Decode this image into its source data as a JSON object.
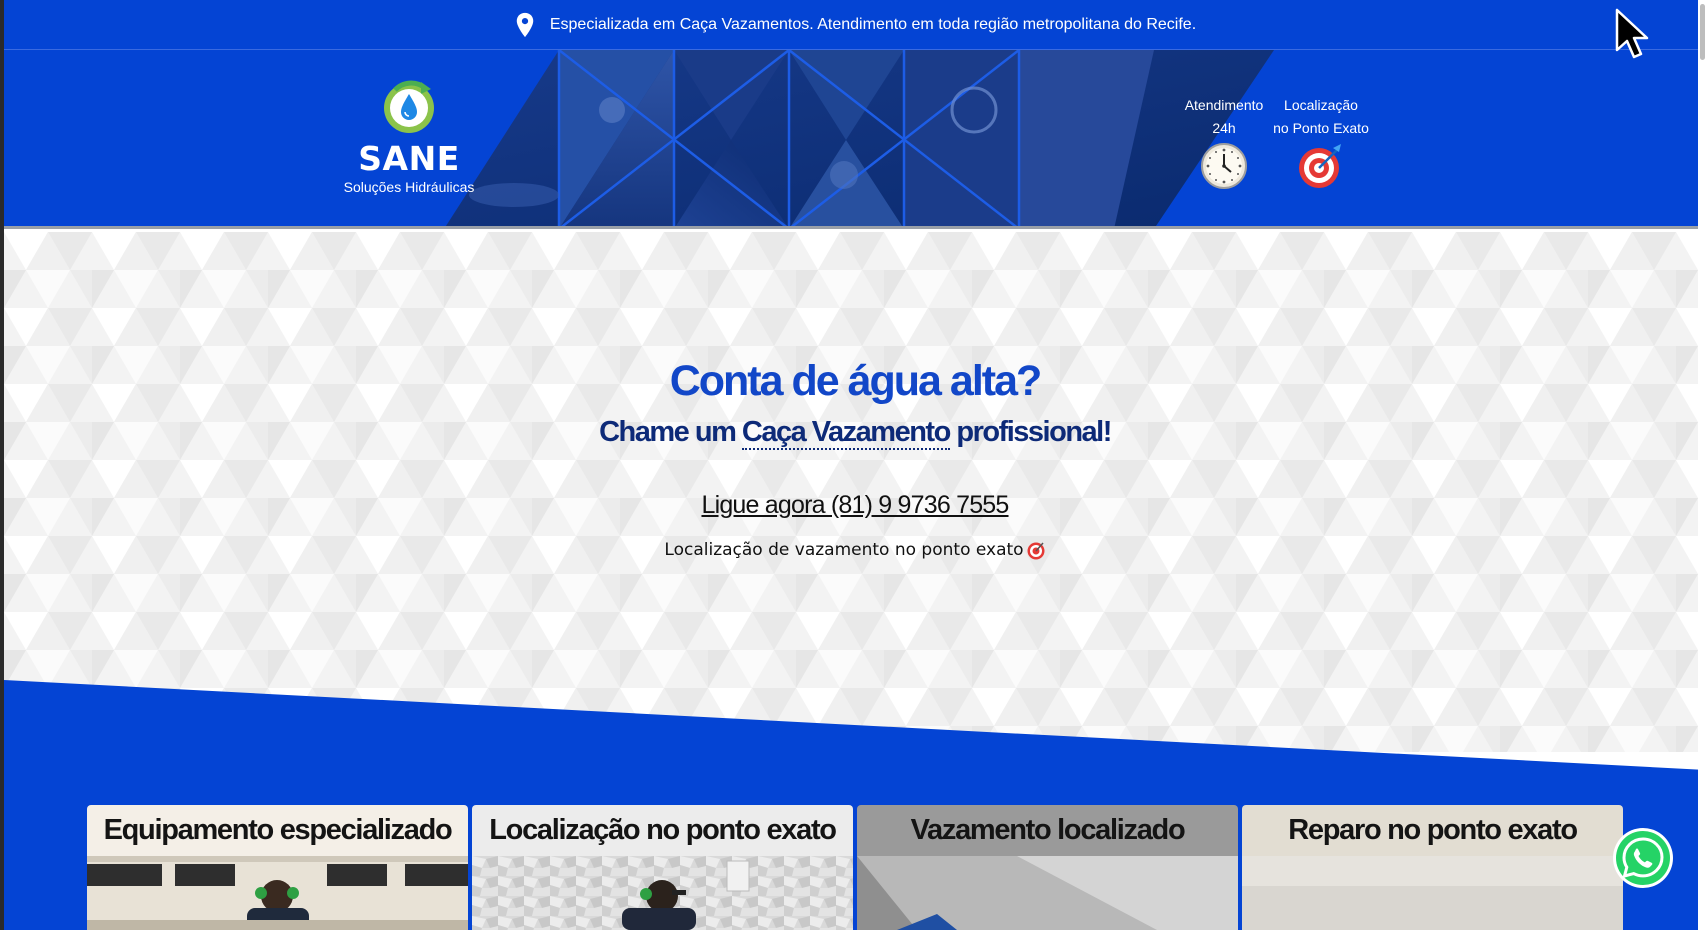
{
  "topbar": {
    "location_icon": "map-pin-icon",
    "text": "Especializada em Caça Vazamentos. Atendimento em toda região metropolitana do Recife."
  },
  "header": {
    "logo": {
      "title": "SANE",
      "subtitle": "Soluções Hidráulicas",
      "icon": "water-drop-recycle-icon"
    },
    "features": [
      {
        "line1": "Atendimento",
        "line2": "24h",
        "icon": "clock-icon"
      },
      {
        "line1": "Localização",
        "line2": "no Ponto Exato",
        "icon": "target-icon"
      }
    ]
  },
  "hero": {
    "title": "Conta de água alta?",
    "subtitle_pre": "Chame um ",
    "subtitle_link": "Caça Vazamento",
    "subtitle_post": " profissional!",
    "phone_cta": "Ligue agora (81) 9 9736 7555",
    "note": "Localização de vazamento no ponto exato"
  },
  "cards": [
    {
      "title": "Equipamento especializado"
    },
    {
      "title": "Localização no ponto exato"
    },
    {
      "title": "Vazamento localizado"
    },
    {
      "title": "Reparo no ponto exato"
    }
  ],
  "colors": {
    "brand_blue": "#0444d4",
    "hero_title": "#1247c8",
    "hero_sub": "#0d2a78",
    "whatsapp_green": "#25d366"
  }
}
